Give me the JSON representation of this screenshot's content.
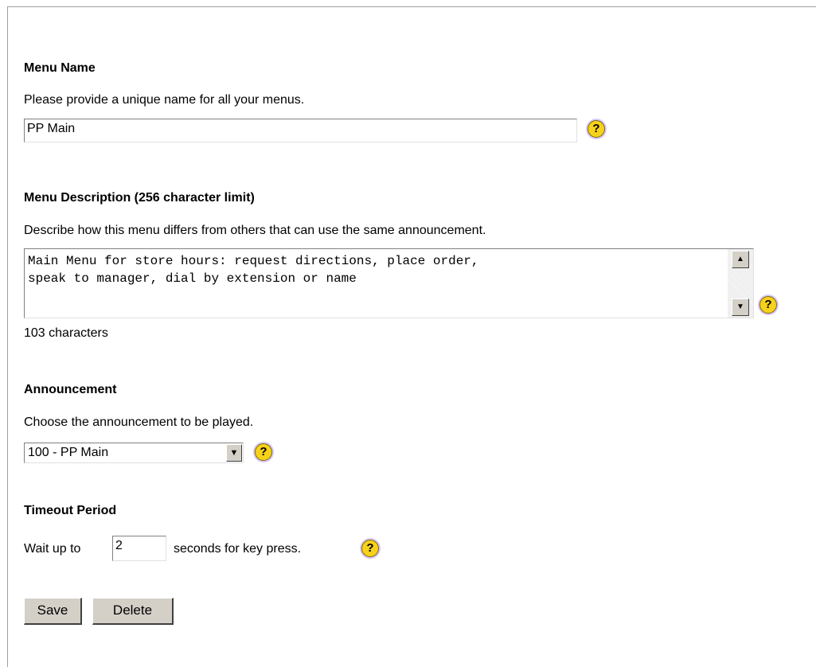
{
  "menu_name": {
    "heading": "Menu Name",
    "description": "Please provide a unique name for all your menus.",
    "value": "PP Main",
    "help_glyph": "?"
  },
  "menu_description": {
    "heading": "Menu Description (256 character limit)",
    "description": "Describe how this menu differs from others that can use the same announcement.",
    "value": "Main Menu for store hours: request directions, place order,\nspeak to manager, dial by extension or name",
    "char_count": "103 characters",
    "help_glyph": "?"
  },
  "announcement": {
    "heading": "Announcement",
    "description": "Choose the announcement to be played.",
    "selected": "100 - PP Main",
    "help_glyph": "?"
  },
  "timeout": {
    "heading": "Timeout Period",
    "prefix": "Wait up to",
    "value": "2",
    "suffix": "seconds for key press.",
    "help_glyph": "?"
  },
  "buttons": {
    "save": "Save",
    "delete": "Delete"
  },
  "colors": {
    "help_icon": "#f7d21b",
    "button_face": "#d4d0c8"
  }
}
